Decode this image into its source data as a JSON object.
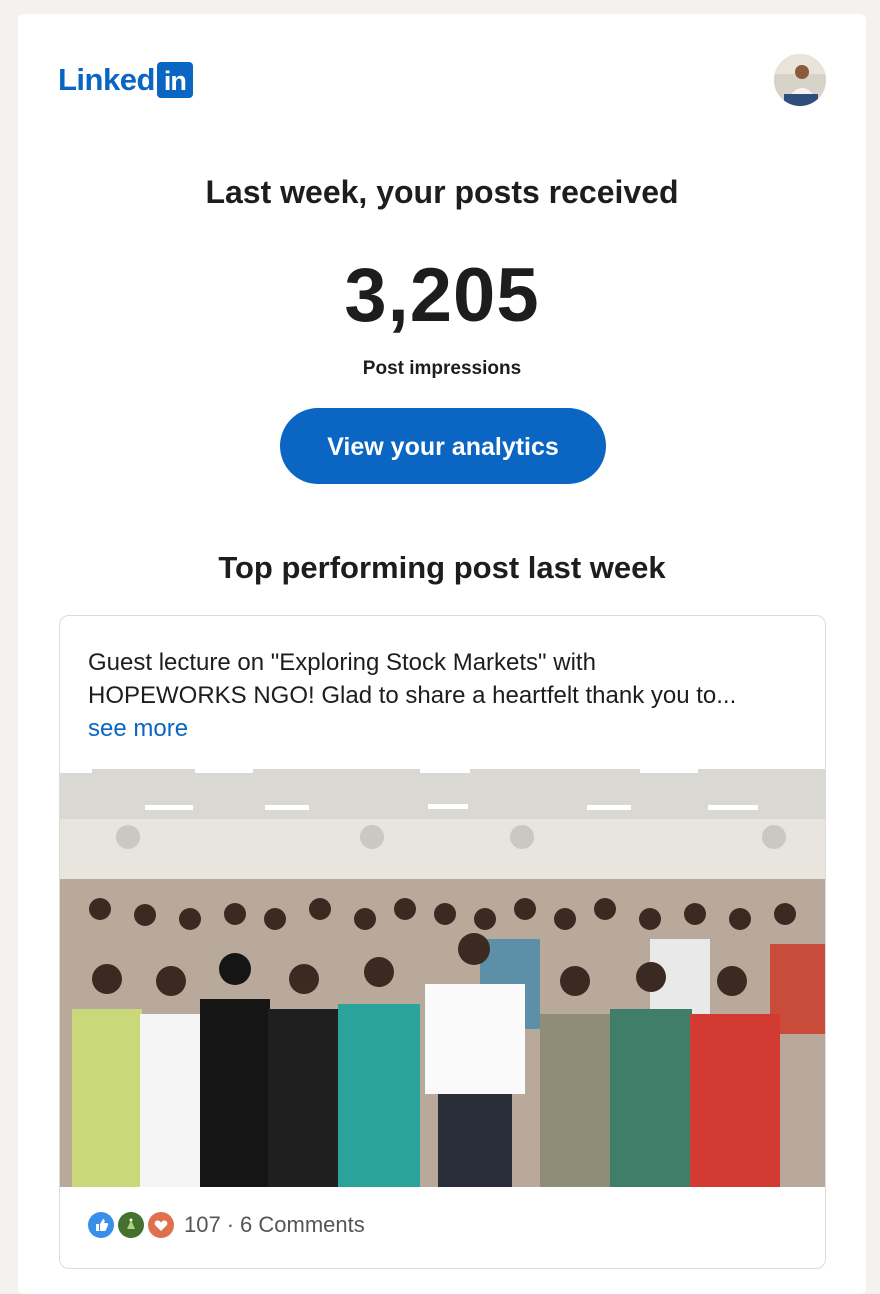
{
  "header": {
    "logo_text": "Linked",
    "logo_box_text": "in",
    "brand_color": "#0a66c2"
  },
  "summary": {
    "headline": "Last week, your posts received",
    "impressions": "3,205",
    "metric_label": "Post impressions",
    "cta_label": "View your analytics"
  },
  "top_post": {
    "section_title": "Top performing post last week",
    "text_line_1": "Guest lecture on \"Exploring Stock Markets\" with",
    "text_line_2": "HOPEWORKS NGO! Glad to share a heartfelt thank you to...",
    "see_more": "see more",
    "reactions": {
      "icons": [
        "like-icon",
        "celebrate-icon",
        "love-icon"
      ],
      "count": "107",
      "separator": "·",
      "comments": "6 Comments"
    }
  }
}
